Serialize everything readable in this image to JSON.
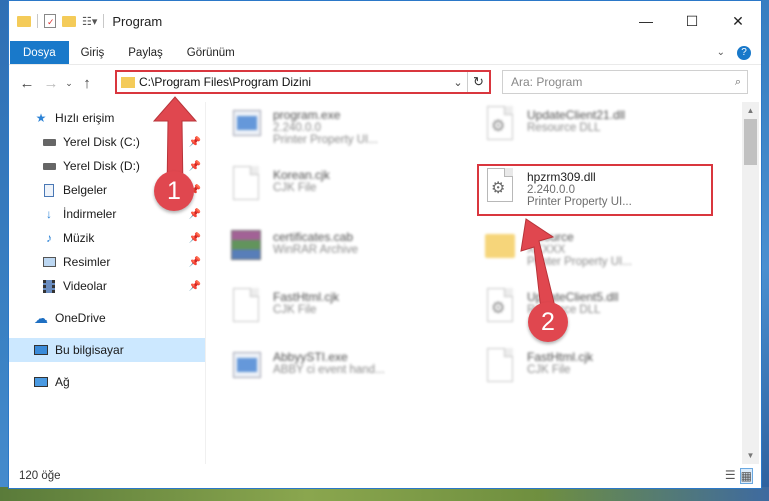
{
  "window": {
    "title": "Program",
    "controls": {
      "minimize": "—",
      "maximize": "☐",
      "close": "✕"
    }
  },
  "ribbon": {
    "tabs": [
      "Dosya",
      "Giriş",
      "Paylaş",
      "Görünüm"
    ],
    "active_tab": 0
  },
  "address": {
    "path": "C:\\Program Files\\Program Dizini",
    "search_placeholder": "Ara: Program"
  },
  "nav": {
    "items": [
      {
        "label": "Hızlı erişim",
        "icon": "star-icon"
      },
      {
        "label": "Yerel Disk (C:)",
        "icon": "drive-icon",
        "pinned": true
      },
      {
        "label": "Yerel Disk (D:)",
        "icon": "drive-icon",
        "pinned": true
      },
      {
        "label": "Belgeler",
        "icon": "documents-icon",
        "pinned": true
      },
      {
        "label": "İndirmeler",
        "icon": "download-icon",
        "pinned": true
      },
      {
        "label": "Müzik",
        "icon": "music-icon",
        "pinned": true
      },
      {
        "label": "Resimler",
        "icon": "pictures-icon",
        "pinned": true
      },
      {
        "label": "Videolar",
        "icon": "videos-icon",
        "pinned": true
      },
      {
        "label": "OneDrive",
        "icon": "cloud-icon"
      },
      {
        "label": "Bu bilgisayar",
        "icon": "computer-icon",
        "selected": true
      },
      {
        "label": "Ağ",
        "icon": "network-icon"
      }
    ]
  },
  "files": [
    {
      "name": "program.exe",
      "l2": "2.240.0.0",
      "l3": "Printer Property UI...",
      "icon": "app-icon",
      "blurred": true
    },
    {
      "name": "UpdateClient21.dll",
      "l2": "Resource DLL",
      "l3": "",
      "icon": "dll-icon",
      "blurred": true
    },
    {
      "name": "Korean.cjk",
      "l2": "CJK File",
      "l3": "",
      "icon": "file-icon",
      "blurred": true
    },
    {
      "name": "hpzrm309.dll",
      "l2": "2.240.0.0",
      "l3": "Printer Property UI...",
      "icon": "dll-icon",
      "blurred": false,
      "highlighted": true
    },
    {
      "name": "certificates.cab",
      "l2": "WinRAR Archive",
      "l3": "",
      "icon": "archive-icon",
      "blurred": true
    },
    {
      "name": "resource",
      "l2": "XXXXX",
      "l3": "Printer Property UI...",
      "icon": "folder-icon",
      "blurred": true
    },
    {
      "name": "FastHtml.cjk",
      "l2": "CJK File",
      "l3": "",
      "icon": "file-icon",
      "blurred": true
    },
    {
      "name": "UpdateClient5.dll",
      "l2": "Resource DLL",
      "l3": "",
      "icon": "dll-icon",
      "blurred": true
    },
    {
      "name": "AbbyySTI.exe",
      "l2": "ABBY ci event hand...",
      "l3": "",
      "icon": "app-icon",
      "blurred": true
    },
    {
      "name": "FastHtml.cjk",
      "l2": "CJK File",
      "l3": "",
      "icon": "file-icon",
      "blurred": true
    }
  ],
  "status": {
    "count": "120 öğe"
  },
  "annotations": {
    "badge1": "1",
    "badge2": "2",
    "color": "#e0474f"
  }
}
